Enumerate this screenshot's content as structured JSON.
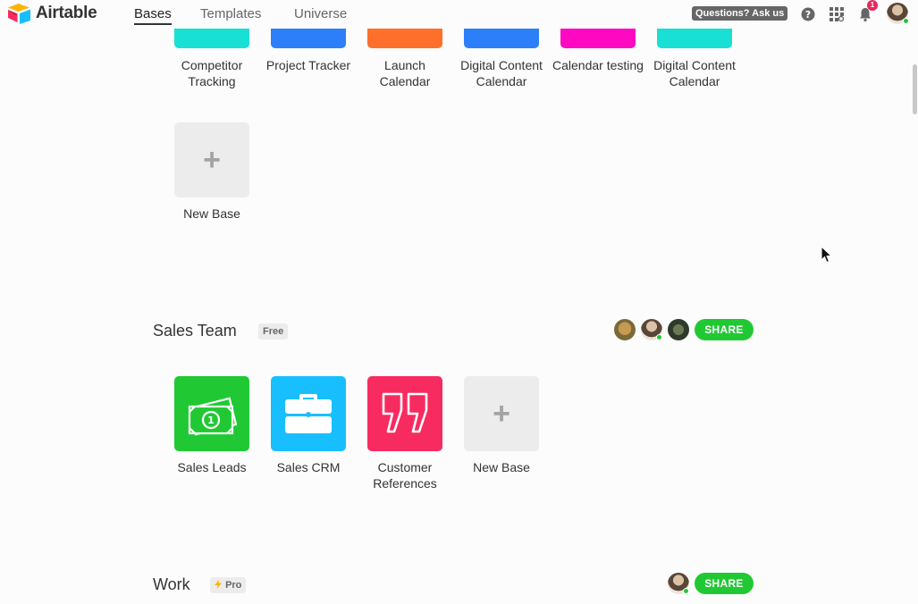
{
  "app": {
    "name": "Airtable"
  },
  "nav": {
    "tabs": [
      {
        "label": "Bases",
        "active": true
      },
      {
        "label": "Templates",
        "active": false
      },
      {
        "label": "Universe",
        "active": false
      }
    ],
    "ask_label": "Questions? Ask us",
    "notification_count": "1",
    "icons": [
      "help-icon",
      "apps-search-icon",
      "bell-icon"
    ]
  },
  "top_bases": [
    {
      "label": "Competitor Tracking",
      "color": "#18e0d4"
    },
    {
      "label": "Project Tracker",
      "color": "#2d7ff9"
    },
    {
      "label": "Launch Calendar",
      "color": "#ff6f2c"
    },
    {
      "label": "Digital Content Calendar",
      "color": "#2d7ff9"
    },
    {
      "label": "Calendar testing",
      "color": "#ff08c2"
    },
    {
      "label": "Digital Content Calendar",
      "color": "#18e0d4"
    }
  ],
  "top_new_base_label": "New Base",
  "workspaces": [
    {
      "title": "Sales Team",
      "plan": "Free",
      "share_label": "SHARE",
      "bases": [
        {
          "label": "Sales Leads",
          "color": "#20c933",
          "icon": "money-icon"
        },
        {
          "label": "Sales CRM",
          "color": "#18bfff",
          "icon": "briefcase-icon"
        },
        {
          "label": "Customer References",
          "color": "#f82b60",
          "icon": "quote-icon"
        }
      ],
      "new_base_label": "New Base"
    },
    {
      "title": "Work",
      "plan": "Pro",
      "share_label": "SHARE"
    }
  ],
  "colors": {
    "share": "#20c933",
    "badge": "#e8275c"
  }
}
